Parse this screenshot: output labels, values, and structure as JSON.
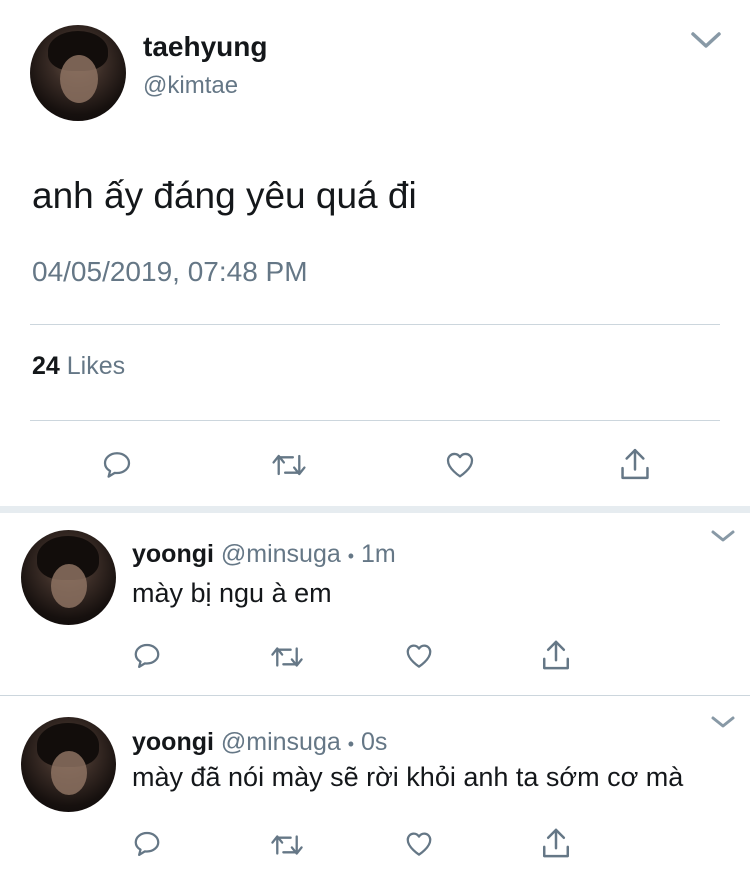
{
  "main_tweet": {
    "display_name": "taehyung",
    "handle": "@kimtae",
    "text": "anh ấy đáng yêu quá đi",
    "timestamp": "04/05/2019, 07:48 PM",
    "likes_count": "24",
    "likes_label": "Likes"
  },
  "replies": [
    {
      "display_name": "yoongi",
      "handle": "@minsuga",
      "dot": "•",
      "time": "1m",
      "text": "mày bị ngu à em"
    },
    {
      "display_name": "yoongi",
      "handle": "@minsuga",
      "dot": "•",
      "time": "0s",
      "text": "mày đã nói mày sẽ rời khỏi anh ta sớm cơ mà"
    }
  ],
  "icons": {
    "reply": "reply-icon",
    "retweet": "retweet-icon",
    "like": "heart-icon",
    "share": "share-icon",
    "menu": "chevron-down-icon"
  },
  "colors": {
    "text": "#14171a",
    "muted": "#657786",
    "divider": "#ccd6dd"
  }
}
